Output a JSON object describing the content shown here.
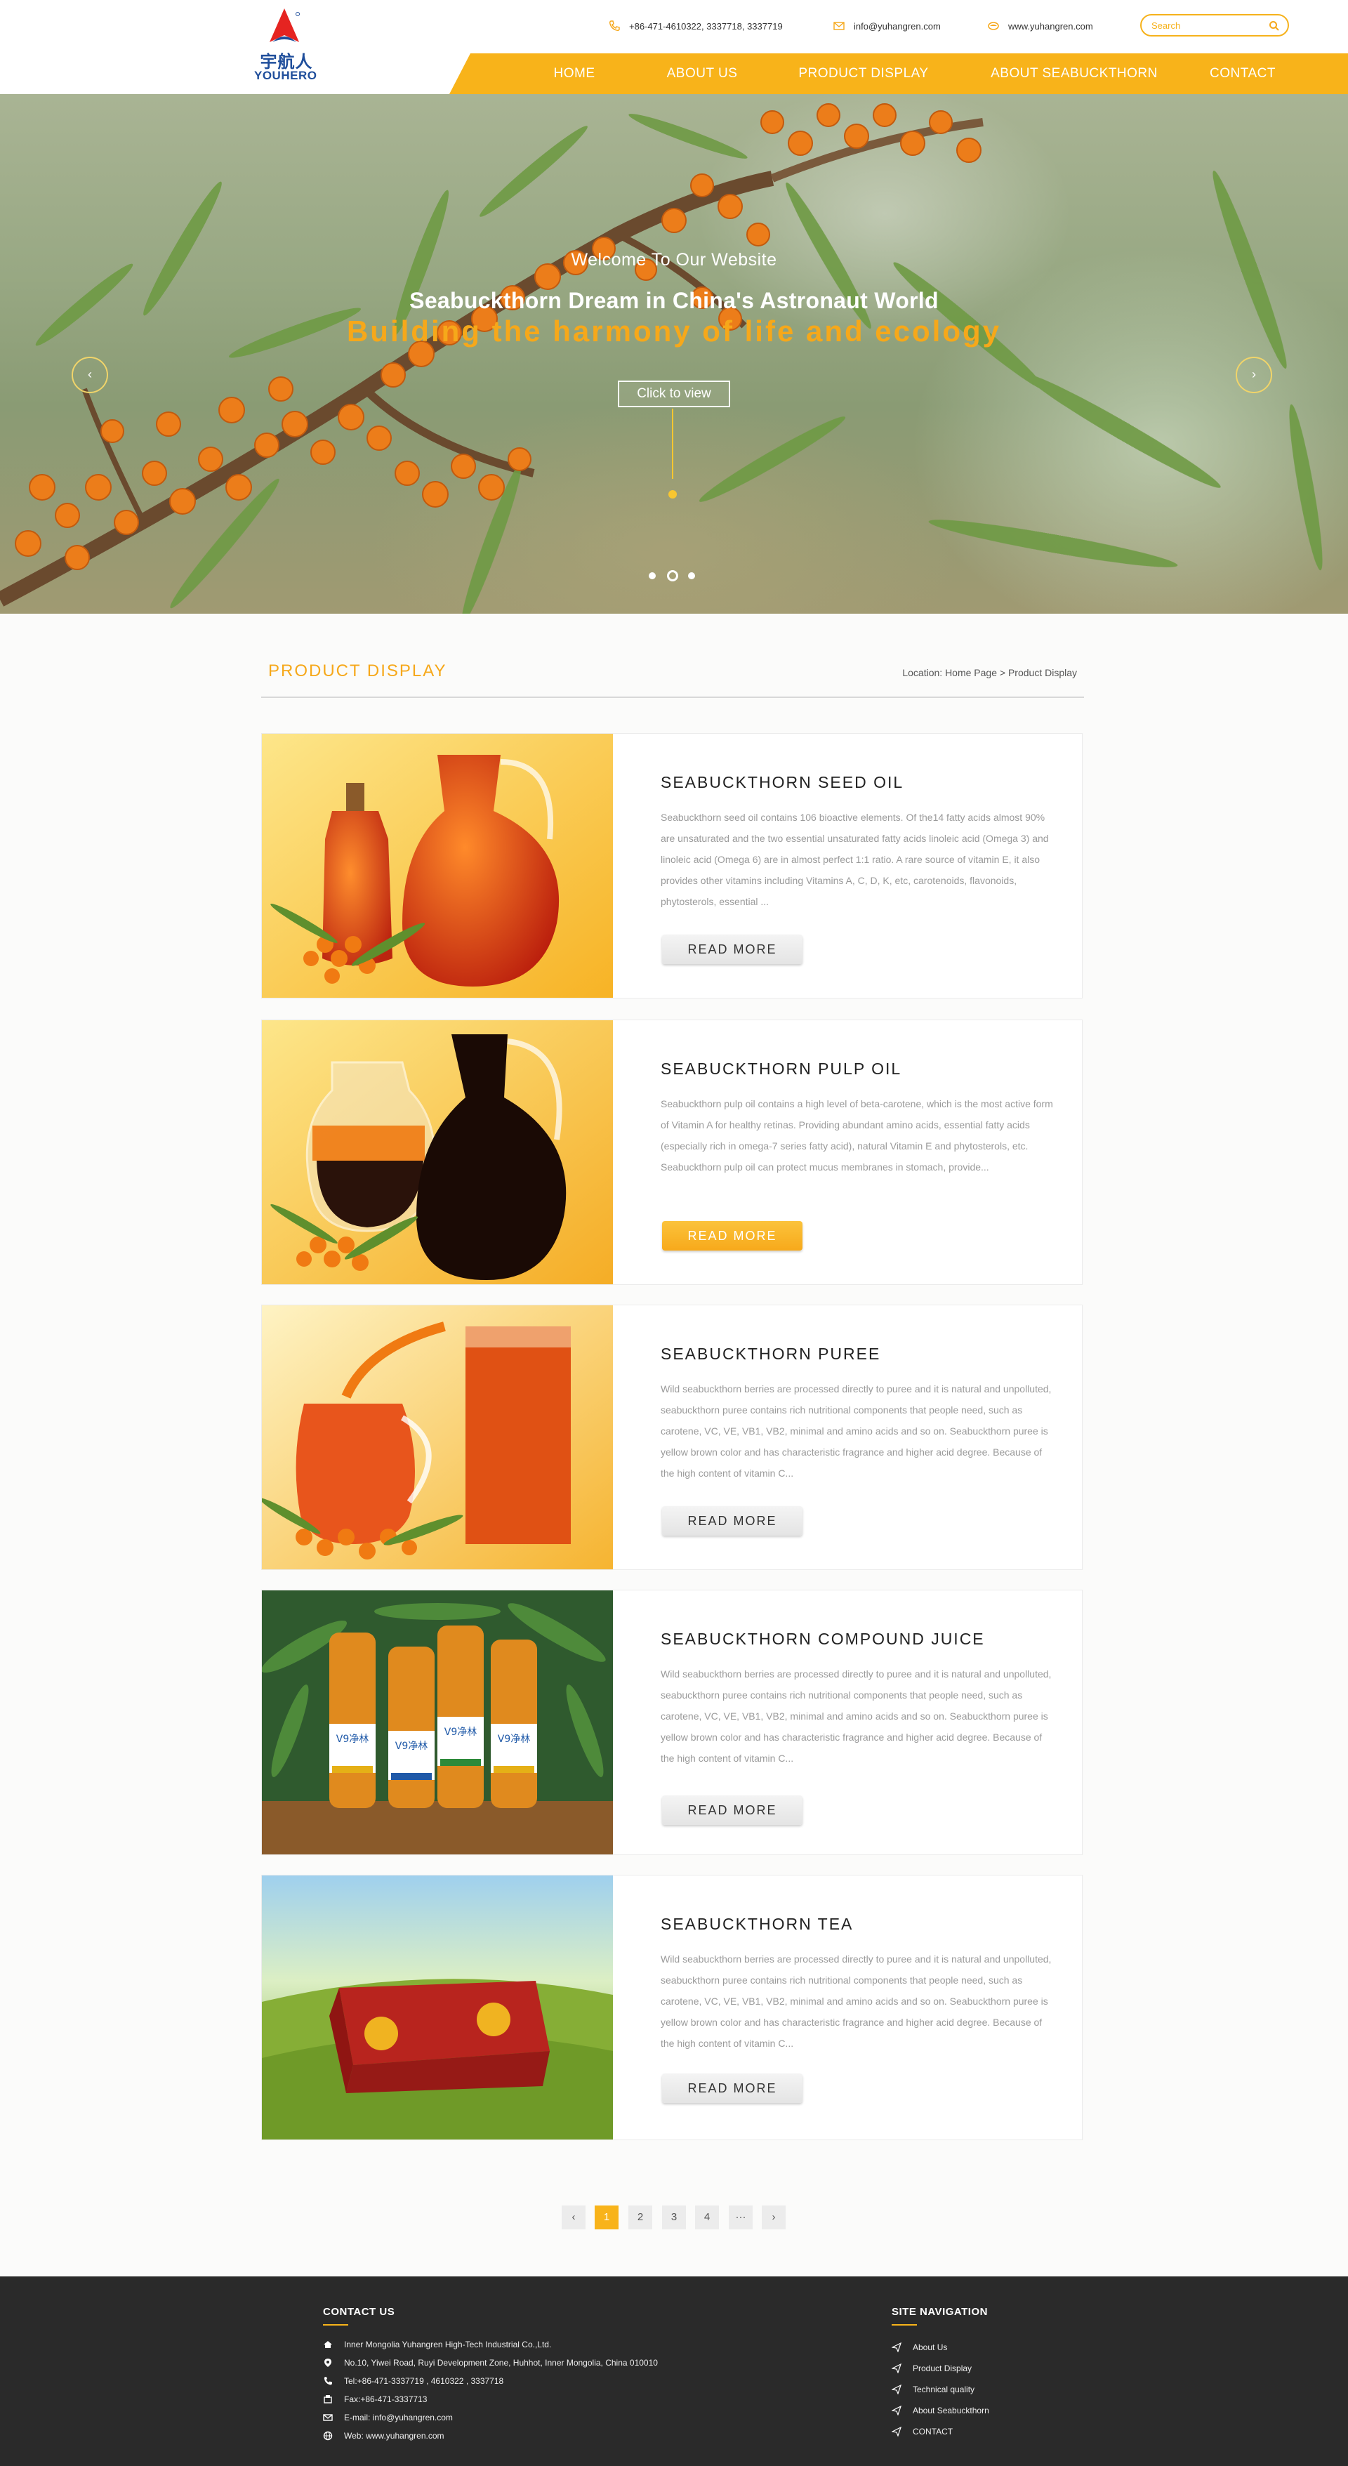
{
  "header": {
    "logo_cn": "宇航人",
    "logo_en": "YOUHERO",
    "phone": "+86-471-4610322,  3337718,  3337719",
    "email": "info@yuhangren.com",
    "website": "www.yuhangren.com",
    "search_placeholder": "Search",
    "accent_color": "#f8b31a",
    "nav": [
      {
        "label": "HOME"
      },
      {
        "label": "ABOUT US"
      },
      {
        "label": "PRODUCT DISPLAY"
      },
      {
        "label": "ABOUT SEABUCKTHORN"
      },
      {
        "label": "CONTACT"
      }
    ]
  },
  "banner": {
    "welcome": "Welcome To Our Website",
    "dream": "Seabuckthorn Dream in China's Astronaut World",
    "building": "Building the harmony of life and ecology",
    "button": "Click to view",
    "prev_icon": "‹",
    "next_icon": "›",
    "slide_count": 3,
    "active_slide": 2
  },
  "section": {
    "title": "PRODUCT  DISPLAY",
    "breadcrumb": "Location: Home Page > Product Display"
  },
  "products": [
    {
      "title": "SEABUCKTHORN  SEED  OIL",
      "desc": [
        "Seabuckthorn seed oil contains 106 bioactive elements. Of the14 fatty acids almost 90% are unsaturated and the two essential unsaturated fatty acids linoleic acid (Omega 3) and linoleic acid (Omega 6) are in almost perfect 1:1 ratio. A rare source of vitamin E, it also provides other vitamins including Vitamins A, C, D, K, etc, carotenoids, flavonoids, phytosterols, essential ..."
      ],
      "button": "READ MORE"
    },
    {
      "title": "SEABUCKTHORN  PULP  OIL",
      "desc": [
        "Seabuckthorn pulp oil contains a high level of beta-carotene, which is the most active form of Vitamin A for healthy retinas. Providing abundant amino acids, essential fatty acids (especially rich in omega-7 series fatty acid), natural Vitamin E and phytosterols, etc.",
        "Seabuckthorn pulp oil can protect mucus membranes in stomach, provide..."
      ],
      "button": "READ MORE"
    },
    {
      "title": "SEABUCKTHORN  PUREE",
      "desc": [
        "Wild seabuckthorn berries are processed directly to puree and it is natural and unpolluted, seabuckthorn puree contains rich nutritional components that people need, such as carotene, VC, VE, VB1, VB2, minimal and amino acids and so on. Seabuckthorn puree is yellow brown color and has characteristic fragrance and higher acid degree. Because of the high content of vitamin C..."
      ],
      "button": "READ MORE"
    },
    {
      "title": "SEABUCKTHORN  COMPOUND  JUICE",
      "desc": [
        "Wild seabuckthorn berries are processed directly to puree and it is natural and unpolluted, seabuckthorn puree contains rich nutritional components that people need, such as carotene, VC, VE, VB1, VB2, minimal and amino acids and so on. Seabuckthorn puree is yellow brown color and has characteristic fragrance and higher acid degree. Because of the high content of vitamin C..."
      ],
      "button": "READ MORE",
      "bottle_label": "V9净林"
    },
    {
      "title": "SEABUCKTHORN  TEA",
      "desc": [
        "Wild seabuckthorn berries are processed directly to puree and it is natural and unpolluted, seabuckthorn puree contains rich nutritional components that people need, such as carotene, VC, VE, VB1, VB2, minimal and amino acids and so on. Seabuckthorn puree is yellow brown color and has characteristic fragrance and higher acid degree. Because of the high content of vitamin C..."
      ],
      "button": "READ MORE"
    }
  ],
  "pagination": {
    "prev": "‹",
    "pages": [
      "1",
      "2",
      "3",
      "4",
      "···"
    ],
    "next": "›",
    "current": "1"
  },
  "footer": {
    "contact_title": "CONTACT US",
    "contact": [
      {
        "icon": "home-icon",
        "text": "Inner Mongolia Yuhangren High-Tech Industrial Co.,Ltd."
      },
      {
        "icon": "location-icon",
        "text": "No.10, Yiwei Road, Ruyi Development Zone, Huhhot, Inner Mongolia, China 010010"
      },
      {
        "icon": "phone-icon",
        "text": "Tel:+86-471-3337719 , 4610322 , 3337718"
      },
      {
        "icon": "fax-icon",
        "text": "Fax:+86-471-3337713"
      },
      {
        "icon": "mail-icon",
        "text": "E-mail: info@yuhangren.com"
      },
      {
        "icon": "web-icon",
        "text": "Web: www.yuhangren.com"
      }
    ],
    "nav_title": "SITE NAVIGATION",
    "links": [
      "About Us",
      "Product Display",
      "Technical quality",
      "About Seabuckthorn",
      "CONTACT"
    ]
  }
}
